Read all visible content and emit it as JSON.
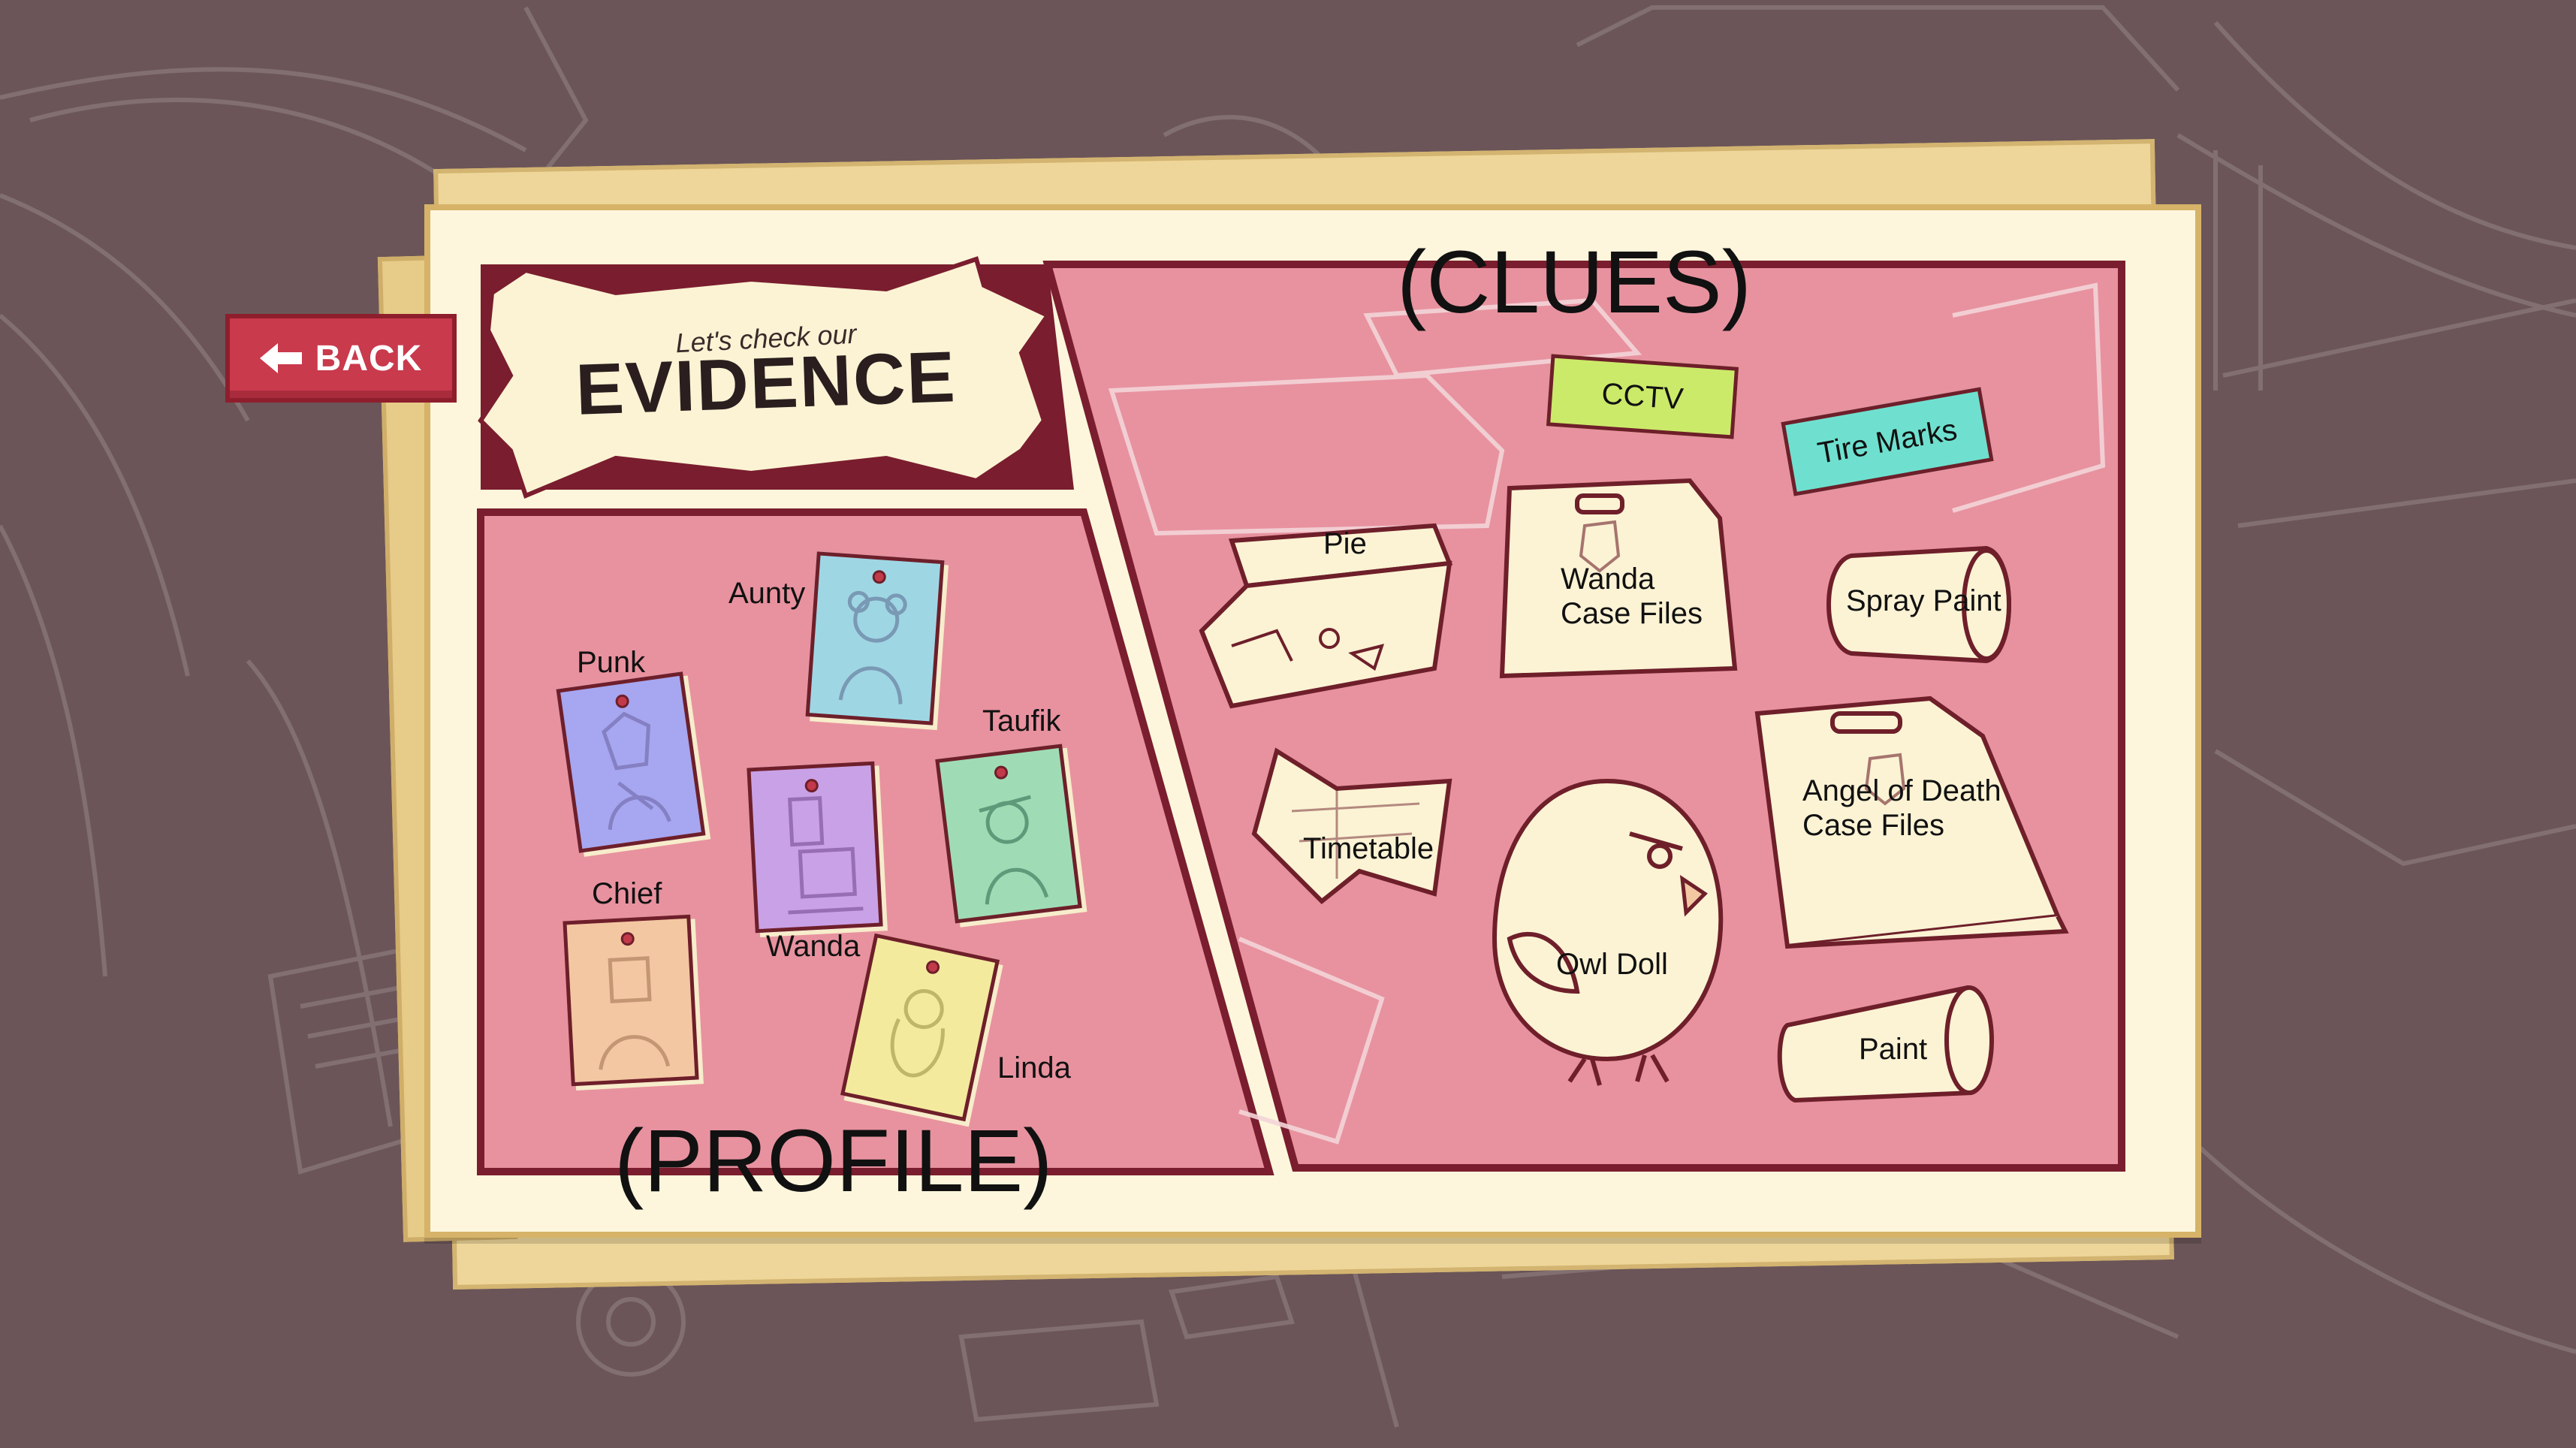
{
  "back_button": {
    "label": "BACK"
  },
  "title": {
    "line1": "Let's check our",
    "line2": "EVIDENCE"
  },
  "sections": {
    "clues": "(CLUES)",
    "profile": "(PROFILE)"
  },
  "profiles": [
    {
      "name": "Aunty",
      "color": "#9fd6e4"
    },
    {
      "name": "Punk",
      "color": "#a7a6f0"
    },
    {
      "name": "Taufik",
      "color": "#9fdcb5"
    },
    {
      "name": "Chief",
      "color": "#f3c7a2"
    },
    {
      "name": "Wanda",
      "color": "#c9a1e6"
    },
    {
      "name": "Linda",
      "color": "#f3ea9e"
    }
  ],
  "clues": [
    {
      "name": "CCTV",
      "color": "#ccea6a"
    },
    {
      "name": "Tire Marks",
      "color": "#6fe0cf"
    },
    {
      "name": "Pie"
    },
    {
      "name": "Wanda\nCase Files"
    },
    {
      "name": "Spray Paint"
    },
    {
      "name": "Timetable"
    },
    {
      "name": "Angel of Death\nCase Files"
    },
    {
      "name": "Owl Doll"
    },
    {
      "name": "Paint"
    }
  ],
  "colors": {
    "panel": "#e8929f",
    "frame": "#7a1d2e",
    "board": "#fdf6dc",
    "background": "#6b5558"
  }
}
